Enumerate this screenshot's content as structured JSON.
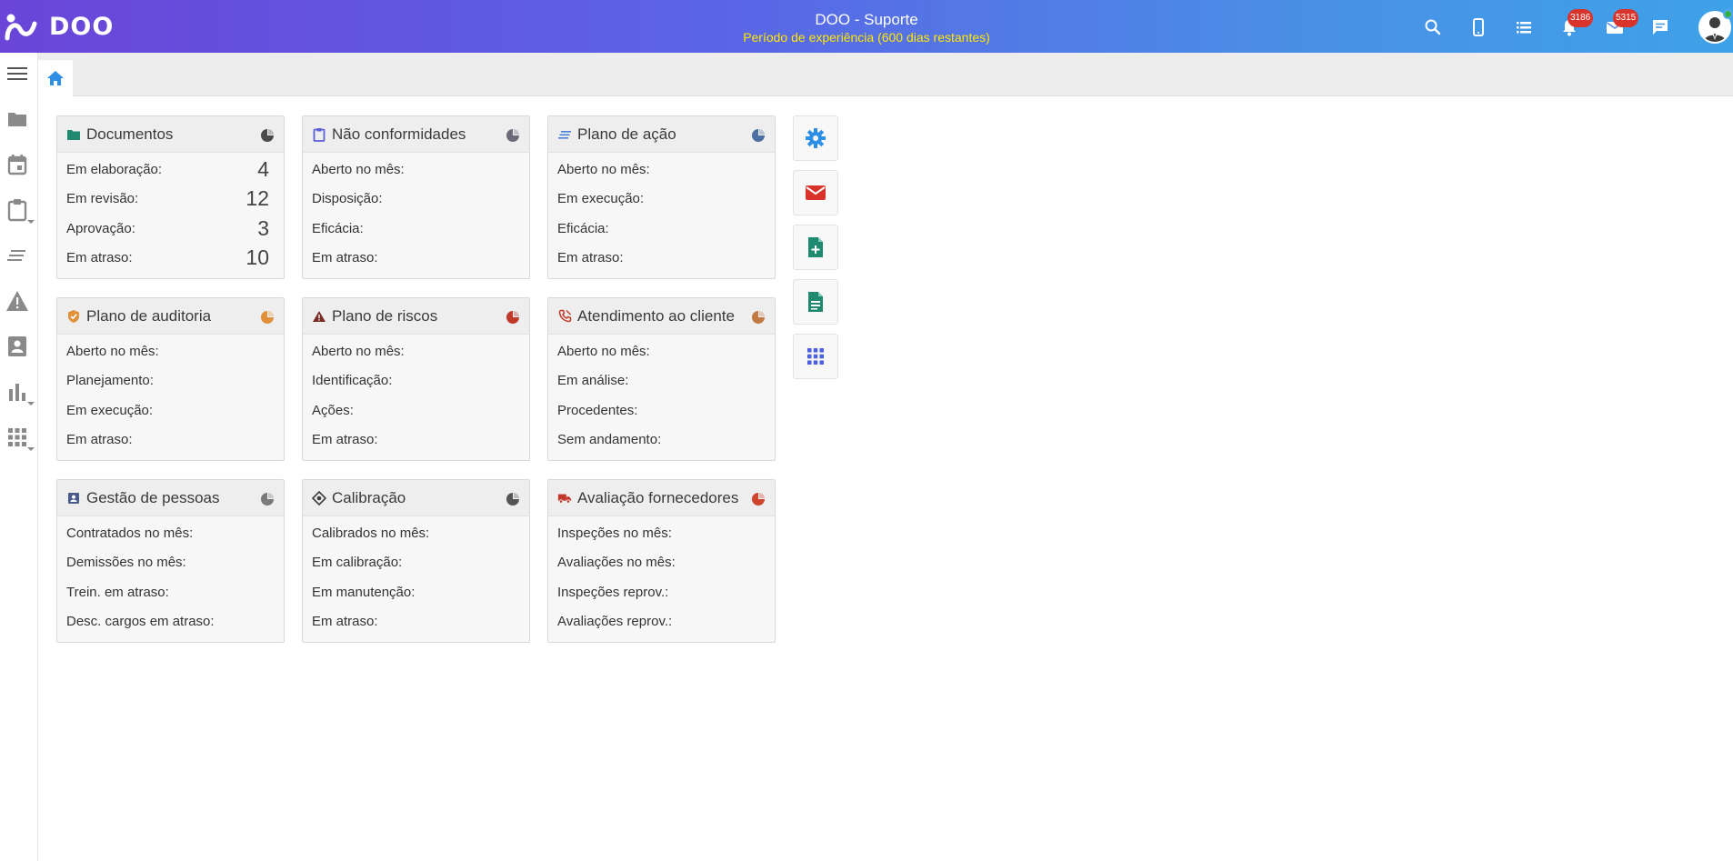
{
  "header": {
    "logo_text": "DOO",
    "title": "DOO - Suporte",
    "trial_text": "Período de experiência (600 dias restantes)",
    "notifications_count": "3186",
    "messages_count": "5315"
  },
  "colors": {
    "gradient_start": "#6a45d8",
    "gradient_end": "#3ea2e8",
    "trial_text": "#ffe600",
    "badge": "#d9342b",
    "accent_blue": "#2d8ee6"
  },
  "cards": [
    {
      "title": "Documentos",
      "icon": "folder-icon",
      "rows": [
        {
          "label": "Em elaboração:",
          "value": "4"
        },
        {
          "label": "Em revisão:",
          "value": "12"
        },
        {
          "label": "Aprovação:",
          "value": "3"
        },
        {
          "label": "Em atraso:",
          "value": "10"
        }
      ]
    },
    {
      "title": "Não conformidades",
      "icon": "clipboard-icon",
      "rows": [
        {
          "label": "Aberto no mês:",
          "value": ""
        },
        {
          "label": "Disposição:",
          "value": ""
        },
        {
          "label": "Eficácia:",
          "value": ""
        },
        {
          "label": "Em atraso:",
          "value": ""
        }
      ]
    },
    {
      "title": "Plano de ação",
      "icon": "action-plan-icon",
      "rows": [
        {
          "label": "Aberto no mês:",
          "value": ""
        },
        {
          "label": "Em execução:",
          "value": ""
        },
        {
          "label": "Eficácia:",
          "value": ""
        },
        {
          "label": "Em atraso:",
          "value": ""
        }
      ]
    },
    {
      "title": "Plano de auditoria",
      "icon": "shield-check-icon",
      "rows": [
        {
          "label": "Aberto no mês:",
          "value": ""
        },
        {
          "label": "Planejamento:",
          "value": ""
        },
        {
          "label": "Em execução:",
          "value": ""
        },
        {
          "label": "Em atraso:",
          "value": ""
        }
      ]
    },
    {
      "title": "Plano de riscos",
      "icon": "warning-icon",
      "rows": [
        {
          "label": "Aberto no mês:",
          "value": ""
        },
        {
          "label": "Identificação:",
          "value": ""
        },
        {
          "label": "Ações:",
          "value": ""
        },
        {
          "label": "Em atraso:",
          "value": ""
        }
      ]
    },
    {
      "title": "Atendimento ao cliente",
      "icon": "phone-icon",
      "rows": [
        {
          "label": "Aberto no mês:",
          "value": ""
        },
        {
          "label": "Em análise:",
          "value": ""
        },
        {
          "label": "Procedentes:",
          "value": ""
        },
        {
          "label": "Sem andamento:",
          "value": ""
        }
      ]
    },
    {
      "title": "Gestão de pessoas",
      "icon": "contact-card-icon",
      "rows": [
        {
          "label": "Contratados no mês:",
          "value": ""
        },
        {
          "label": "Demissões no mês:",
          "value": ""
        },
        {
          "label": "Trein. em atraso:",
          "value": ""
        },
        {
          "label": "Desc. cargos em atraso:",
          "value": ""
        }
      ]
    },
    {
      "title": "Calibração",
      "icon": "target-icon",
      "rows": [
        {
          "label": "Calibrados no mês:",
          "value": ""
        },
        {
          "label": "Em calibração:",
          "value": ""
        },
        {
          "label": "Em manutenção:",
          "value": ""
        },
        {
          "label": "Em atraso:",
          "value": ""
        }
      ]
    },
    {
      "title": "Avaliação fornecedores",
      "icon": "truck-icon",
      "rows": [
        {
          "label": "Inspeções no mês:",
          "value": ""
        },
        {
          "label": "Avaliações no mês:",
          "value": ""
        },
        {
          "label": "Inspeções reprov.:",
          "value": ""
        },
        {
          "label": "Avaliações reprov.:",
          "value": ""
        }
      ]
    }
  ],
  "sidebar_icons": [
    "menu-icon",
    "folder-icon",
    "calendar-icon",
    "clipboard-icon",
    "list-icon",
    "warning-icon",
    "contact-icon",
    "bar-chart-icon",
    "apps-icon"
  ],
  "quick_actions": [
    "settings-icon",
    "mail-icon",
    "add-document-icon",
    "document-icon",
    "apps-grid-icon"
  ]
}
